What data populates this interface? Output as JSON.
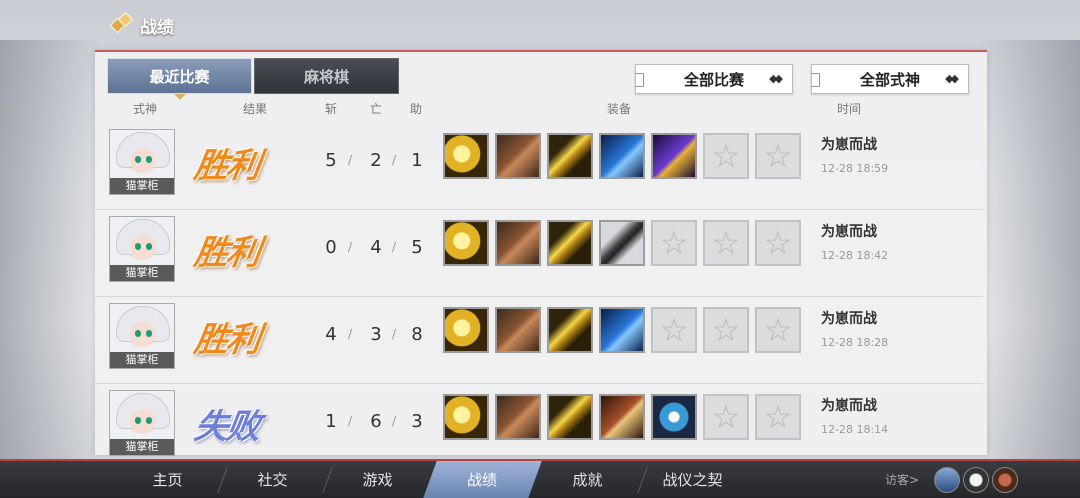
{
  "header": {
    "title": "战绩"
  },
  "tabs": [
    {
      "label": "最近比赛",
      "active": true
    },
    {
      "label": "麻将棋",
      "active": false
    }
  ],
  "filters": {
    "match_filter": "全部比赛",
    "shikigami_filter": "全部式神"
  },
  "columns": {
    "shikigami": "式神",
    "result": "结果",
    "kills": "斩",
    "deaths": "亡",
    "assists": "助",
    "equipment": "装备",
    "time": "时间"
  },
  "rows": [
    {
      "character": "猫掌柜",
      "result": "胜利",
      "kills": "5",
      "deaths": "2",
      "assists": "1",
      "mode": "为崽而战",
      "time": "12-28 18:59",
      "items": [
        "golden-gauntlet-icon",
        "leather-boots-icon",
        "golden-sword-icon",
        "blue-bow-icon",
        "purple-spear-icon",
        "empty-slot-icon",
        "empty-slot-icon"
      ]
    },
    {
      "character": "猫掌柜",
      "result": "胜利",
      "kills": "0",
      "deaths": "4",
      "assists": "5",
      "mode": "为崽而战",
      "time": "12-28 18:42",
      "items": [
        "golden-gauntlet-icon",
        "leather-boots-icon",
        "golden-sword-icon",
        "katana-icon",
        "empty-slot-icon",
        "empty-slot-icon",
        "empty-slot-icon"
      ]
    },
    {
      "character": "猫掌柜",
      "result": "胜利",
      "kills": "4",
      "deaths": "3",
      "assists": "8",
      "mode": "为崽而战",
      "time": "12-28 18:28",
      "items": [
        "golden-gauntlet-icon",
        "leather-boots-icon",
        "golden-sword-icon",
        "blue-bow-icon",
        "empty-slot-icon",
        "empty-slot-icon",
        "empty-slot-icon"
      ]
    },
    {
      "character": "猫掌柜",
      "result": "失败",
      "kills": "1",
      "deaths": "6",
      "assists": "3",
      "mode": "为崽而战",
      "time": "12-28 18:14",
      "items": [
        "golden-gauntlet-icon",
        "leather-boots-icon",
        "golden-sword-icon",
        "crossbow-icon",
        "shuriken-icon",
        "empty-slot-icon",
        "empty-slot-icon"
      ]
    }
  ],
  "nav": {
    "items": [
      "主页",
      "社交",
      "游戏",
      "战绩",
      "成就",
      "战仪之契"
    ],
    "active": "战绩",
    "guest_label": "访客>"
  },
  "colors": {
    "win": "#f08a1c",
    "loss": "#6d7ed8",
    "accent": "#b8423c",
    "active_tab": "#6b85b2"
  }
}
